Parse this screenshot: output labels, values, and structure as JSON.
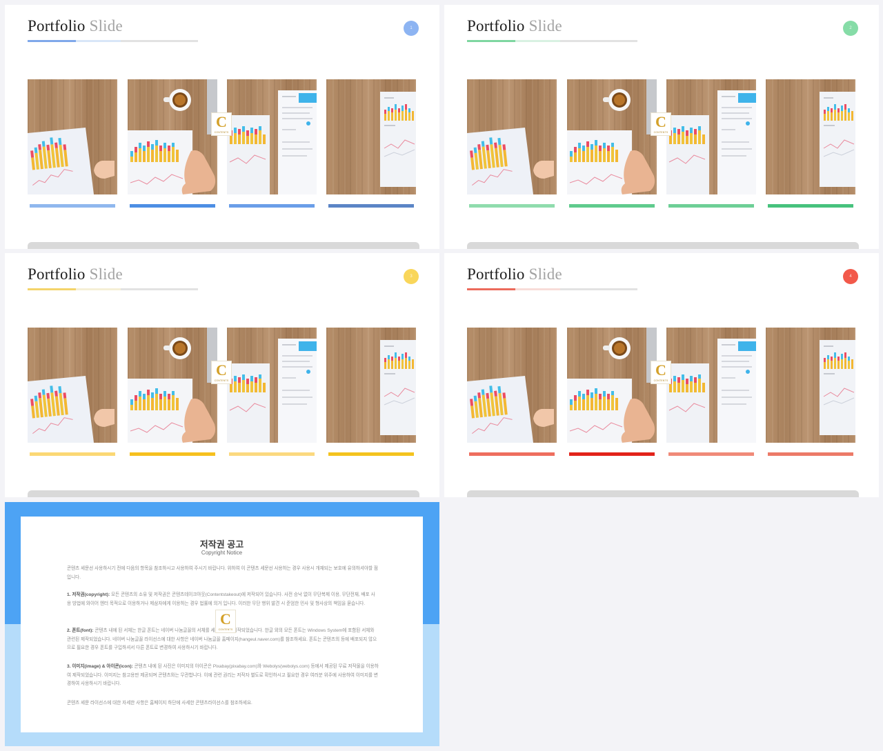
{
  "slides": [
    {
      "title_main": "Portfolio",
      "title_light": "Slide",
      "accent": "#8db4f2",
      "underline": [
        "#7fa8ea",
        "#d8e6f8",
        "#e2e2e2"
      ],
      "bars": [
        "#8fb7ee",
        "#4d8ee4",
        "#6a9ee8",
        "#5b85c6"
      ]
    },
    {
      "title_main": "Portfolio",
      "title_light": "Slide",
      "accent": "#86dca7",
      "underline": [
        "#7ed6a0",
        "#d8f1e2",
        "#e2e2e2"
      ],
      "bars": [
        "#8fdcad",
        "#5fcb8d",
        "#6dcf96",
        "#47c27d"
      ]
    },
    {
      "title_main": "Portfolio",
      "title_light": "Slide",
      "accent": "#f9d65a",
      "underline": [
        "#f4d46a",
        "#f5efd5",
        "#e2e2e2"
      ],
      "bars": [
        "#fbd874",
        "#f6c01e",
        "#fbd97f",
        "#f4c31e"
      ]
    },
    {
      "title_main": "Portfolio",
      "title_light": "Slide",
      "accent": "#f2594a",
      "underline": [
        "#ec6a5b",
        "#f8dcd8",
        "#e2e2e2"
      ],
      "bars": [
        "#ee6e5e",
        "#e2231a",
        "#f08a78",
        "#ec7a68"
      ]
    }
  ],
  "logo": {
    "letter": "C",
    "text": "CONTENTS"
  },
  "copyright": {
    "title": "저작권 공고",
    "subtitle": "Copyright Notice",
    "intro": "콘텐츠 세문선 사용하시기 전에 다음의 항목을 참조하시고 사용하여 주시기 바랍니다. 위하여 이 콘텐츠 세문선 사용하는 경우 사용시 개재되는 보호에 유의하셔야할 점입니다.",
    "p1_head": "1. 저작권(copyright):",
    "p1_body": "모든 콘텐츠의 소유 및 저작권은 콘텐츠테이크아웃(Contentstakeout)에 저작되어 있습니다. 사전 승낙 없이 무단복제 이용, 무단전재, 배포 사용 방법에 와이어 엔터 목적으로 이용하거나 제삼자에게 이용하는 경우 법률에 의거 입니다. 이러한 무단 행위 발견 시 준엄한 민사 및 형사상의 책임을 묻습니다.",
    "p2_head": "2. 폰트(font):",
    "p2_body": "콘텐츠 내에 된 서체는 한글 폰트는 네이버 나눔글꼴의 서체를 세부적으로 제작되었습니다. 한글 외의 모든 폰트는 Windows System에 포함된 서체와 관련된 제작되었습니다. 네이버 나눔글꼴 라이선스에 대한 사항은 네이버 나눔글꼴 홈페이지(hangeul.naver.com)를 참조하세요. 폰트는 콘텐츠의 등에 배포되지 않으므로 필요한 경우 폰트를 구입하셔서 다른 폰트로 변경하여 사용하시기 바랍니다.",
    "p3_head": "3. 이미지(image) & 아이콘(icon):",
    "p3_body": "콘텐츠 내에 된 사진은 이미지의 아이콘은 Pixabay(pixabay.com)와 Webolys(webolys.com) 등에서 제공된 무료 저작물을 이용하여 제작되었습니다. 이미지는 참고용만 제공되며 콘텐츠와는 무관합니다. 이에 관련 권리는 저작자 별도로 확인하시고 필요한 경우 여러분 위주에 사용하여 이미지를 변경하여 사용하시기 바랍니다.",
    "footer": "콘텐츠 세문 라이선스에 대한 자세한 사항은 홈페이지 하단에 사세한 콘텐츠라이선스를 참조하세요."
  }
}
